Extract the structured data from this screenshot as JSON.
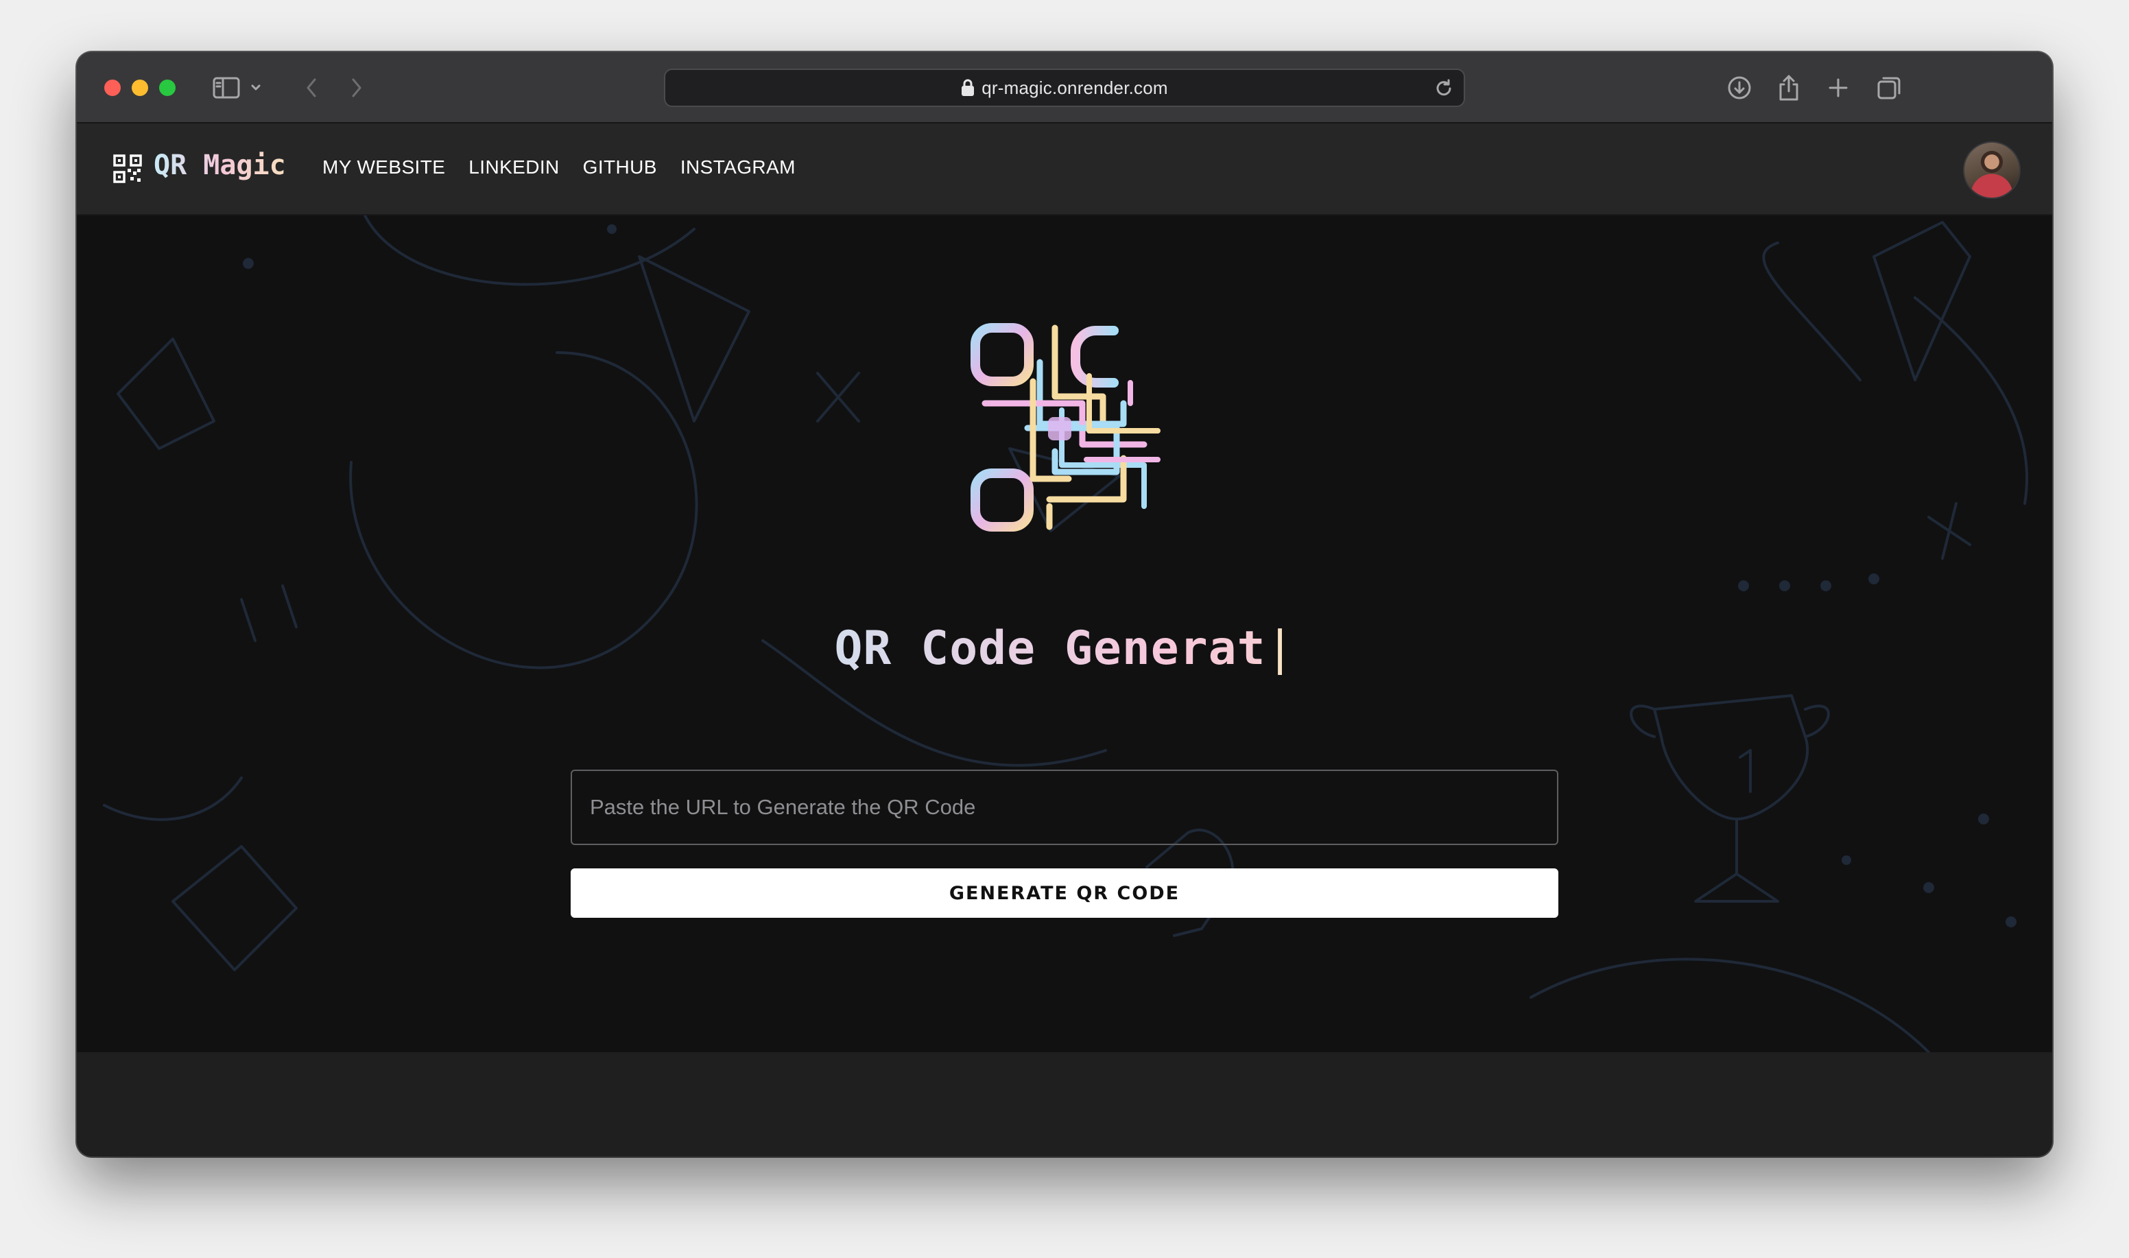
{
  "browser": {
    "url": "qr-magic.onrender.com",
    "icons": [
      "sidebar-icon",
      "chevron-down-icon",
      "back-icon",
      "forward-icon",
      "lock-icon",
      "reload-icon",
      "download-icon",
      "share-icon",
      "new-tab-icon",
      "tab-overview-icon"
    ]
  },
  "navbar": {
    "brand": "QR Magic",
    "links": [
      "MY WEBSITE",
      "LINKEDIN",
      "GITHUB",
      "INSTAGRAM"
    ]
  },
  "hero": {
    "title": "QR Code Generat",
    "caret": "|"
  },
  "form": {
    "placeholder": "Paste the URL to Generate the QR Code",
    "button_label": "GENERATE QR CODE"
  },
  "colors": {
    "gradient": [
      "#c2e8f6",
      "#f7c7da",
      "#f7e2c4"
    ],
    "button_bg": "#ffffff"
  }
}
